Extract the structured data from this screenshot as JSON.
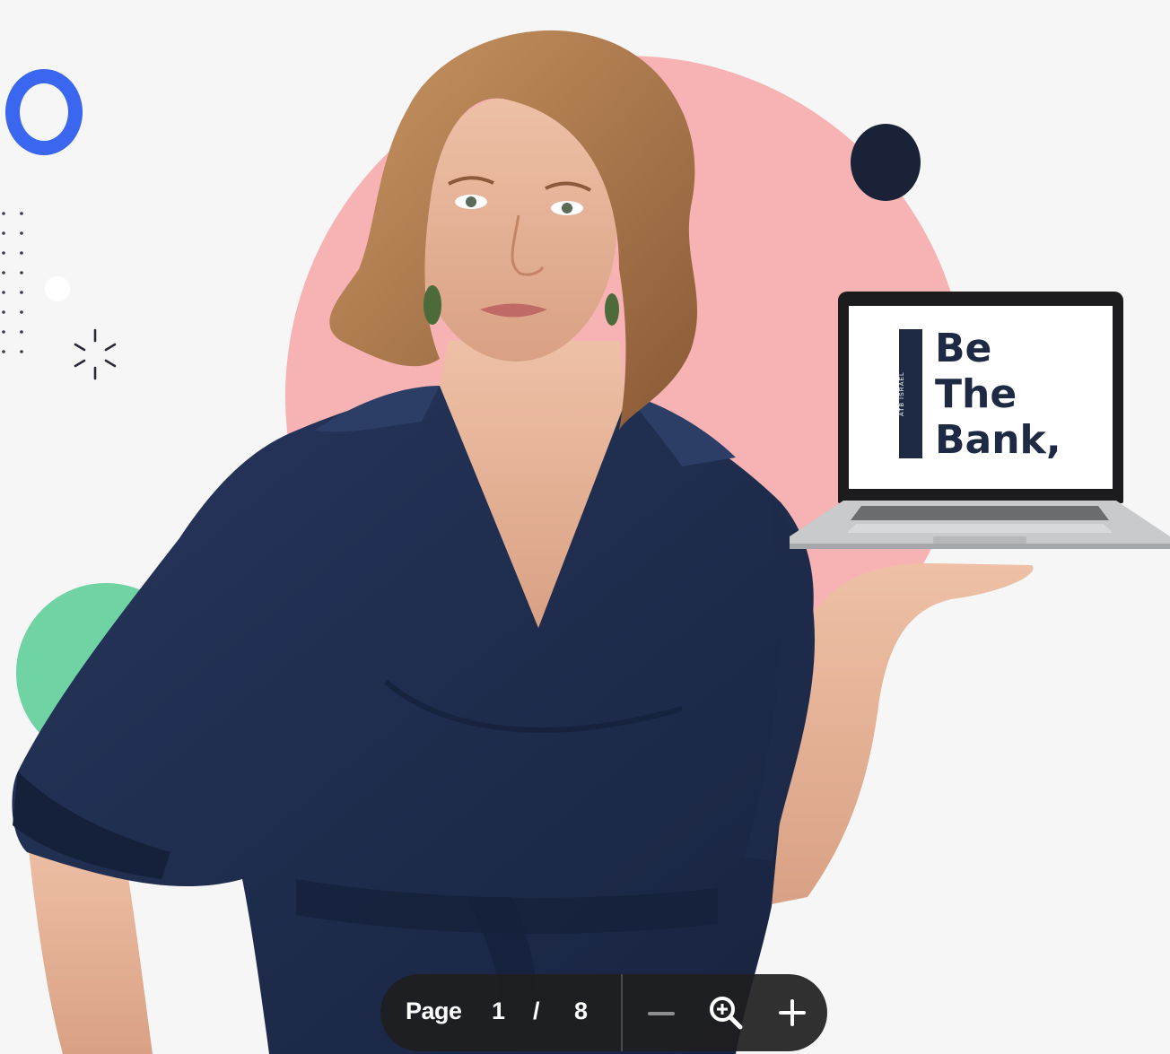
{
  "colors": {
    "background": "#f6f6f7",
    "blue_ring": "#3a66f0",
    "pink_circle": "#f7b3b3",
    "navy_dot": "#1a2238",
    "green_circle": "#6fd3a4",
    "blouse": "#1f2d4f",
    "skin": "#e7b59b",
    "hair": "#b07a4d",
    "toolbar": "#1e1e20"
  },
  "laptop": {
    "screen_title_lines": [
      "Be",
      "The",
      "Bank,"
    ],
    "screen_side_text": "ATB ISRAEL"
  },
  "page_toolbar": {
    "page_label": "Page",
    "current_page": "1",
    "separator": "/",
    "total_pages": "8",
    "zoom_out_icon": "minus-icon",
    "zoom_icon": "zoom-magnifier-icon",
    "zoom_in_icon": "plus-icon"
  }
}
